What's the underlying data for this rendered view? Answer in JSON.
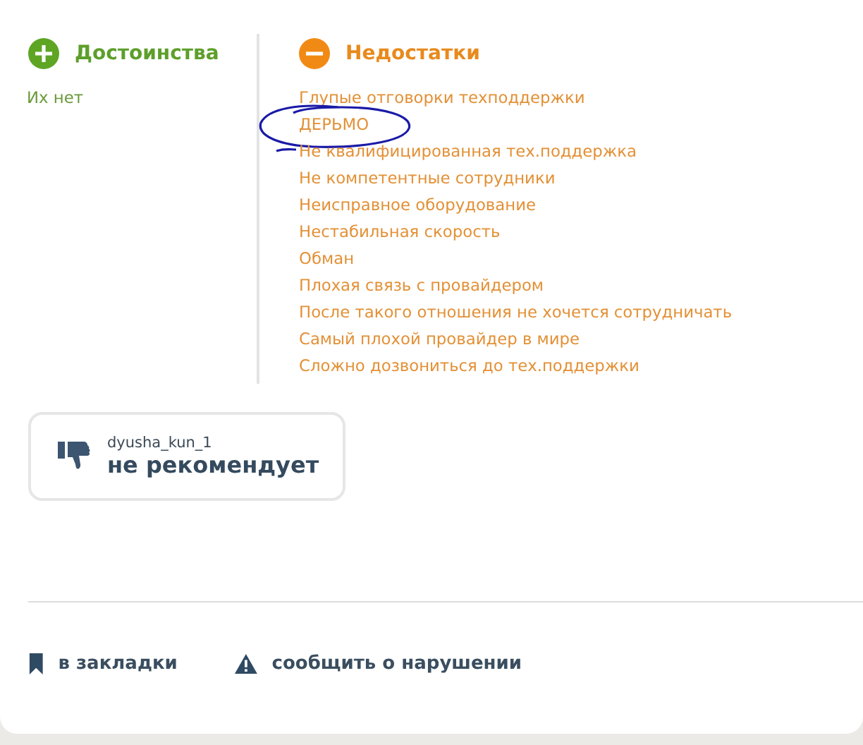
{
  "pros": {
    "title": "Достоинства",
    "items": [
      "Их нет"
    ]
  },
  "cons": {
    "title": "Недостатки",
    "items": [
      {
        "text": "Глупые отговорки техподдержки",
        "circled": false
      },
      {
        "text": "ДЕРЬМО",
        "circled": true
      },
      {
        "text": "Не квалифицированная тех.поддержка",
        "circled": false
      },
      {
        "text": "Не компетентные сотрудники",
        "circled": false
      },
      {
        "text": "Неисправное оборудование",
        "circled": false
      },
      {
        "text": "Нестабильная скорость",
        "circled": false
      },
      {
        "text": "Обман",
        "circled": false
      },
      {
        "text": "Плохая связь с провайдером",
        "circled": false
      },
      {
        "text": "После такого отношения не хочется сотрудничать",
        "circled": false
      },
      {
        "text": "Самый плохой провайдер в мире",
        "circled": false
      },
      {
        "text": "Сложно дозвониться до тех.поддержки",
        "circled": false
      }
    ]
  },
  "verdict": {
    "user": "dyusha_kun_1",
    "text": "не рекомендует",
    "recommends": false
  },
  "actions": [
    {
      "kind": "bookmark",
      "label": "в закладки"
    },
    {
      "kind": "report",
      "label": "сообщить о нарушении"
    }
  ]
}
